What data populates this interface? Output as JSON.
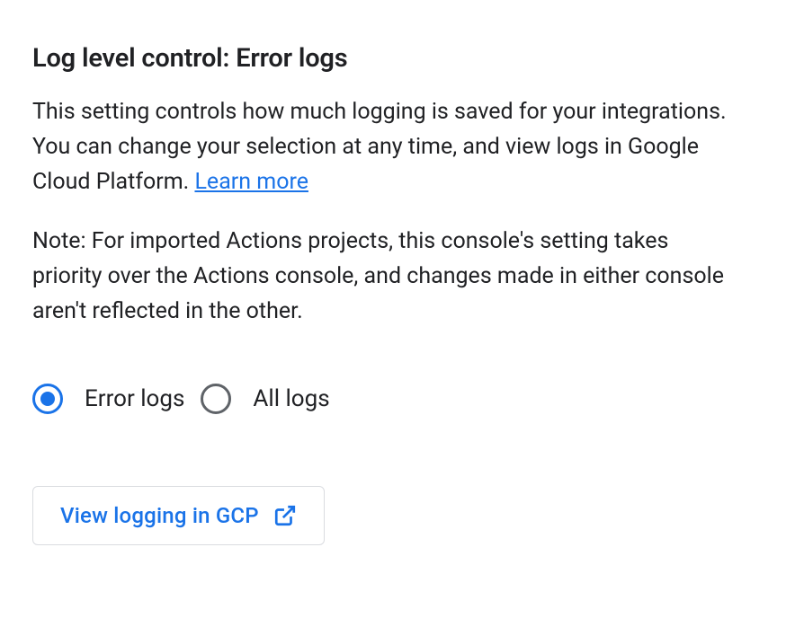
{
  "heading": "Log level control: Error logs",
  "description_part1": "This setting controls how much logging is saved for your integrations. You can change your selection at any time, and view logs in Google Cloud Platform. ",
  "learn_more": "Learn more",
  "note": "Note: For imported Actions projects, this console's setting takes priority over the Actions console, and changes made in either console aren't reflected in the other.",
  "radios": {
    "error_logs": "Error logs",
    "all_logs": "All logs"
  },
  "button": {
    "view_logging": "View logging in GCP"
  },
  "colors": {
    "link": "#1a73e8",
    "text": "#202124",
    "border": "#dadce0",
    "radio_unselected": "#5f6368"
  }
}
